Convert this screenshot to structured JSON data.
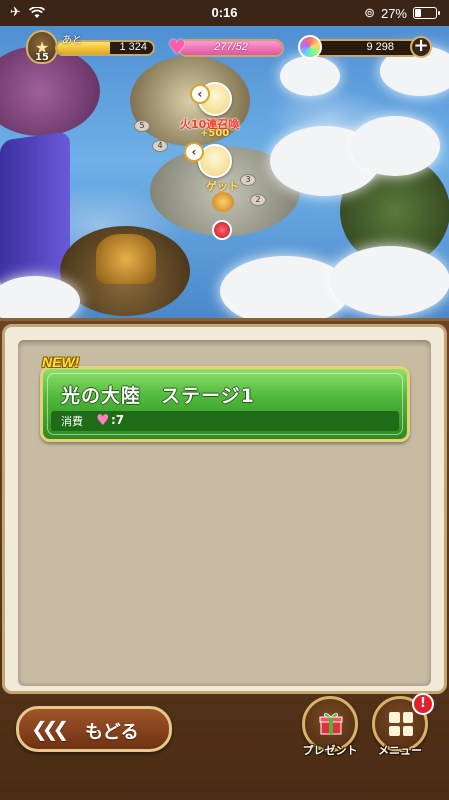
{
  "status_bar": {
    "time": "0:16",
    "battery_percent": "27%",
    "battery_level": 0.27,
    "icons": [
      "airplane-icon",
      "wifi-icon",
      "orientation-lock-icon",
      "battery-icon"
    ]
  },
  "hud": {
    "rank": "15",
    "exp_label": "あと",
    "exp_remaining": "1 324",
    "stamina": "277/52",
    "gems": "9 298",
    "colors": {
      "exp": "#e0a81c",
      "stamina": "#e0569c",
      "frame": "#c7a86a"
    }
  },
  "map": {
    "event_marker_text": "火10連召喚",
    "event_marker_sub": "+500",
    "get_marker_text": "ゲット",
    "stage_nodes": [
      "5",
      "4",
      "3",
      "2"
    ]
  },
  "stage_list": {
    "new_badge": "NEW!",
    "items": [
      {
        "title": "光の大陸　ステージ1",
        "cost_label": "消費",
        "cost_value": ":7"
      }
    ],
    "colors": {
      "card": "#4fb83c",
      "card_border": "#e8d074"
    }
  },
  "buttons": {
    "back_label": "もどる",
    "present_label": "プレゼント",
    "menu_label": "メニュー",
    "menu_alert": "!"
  }
}
